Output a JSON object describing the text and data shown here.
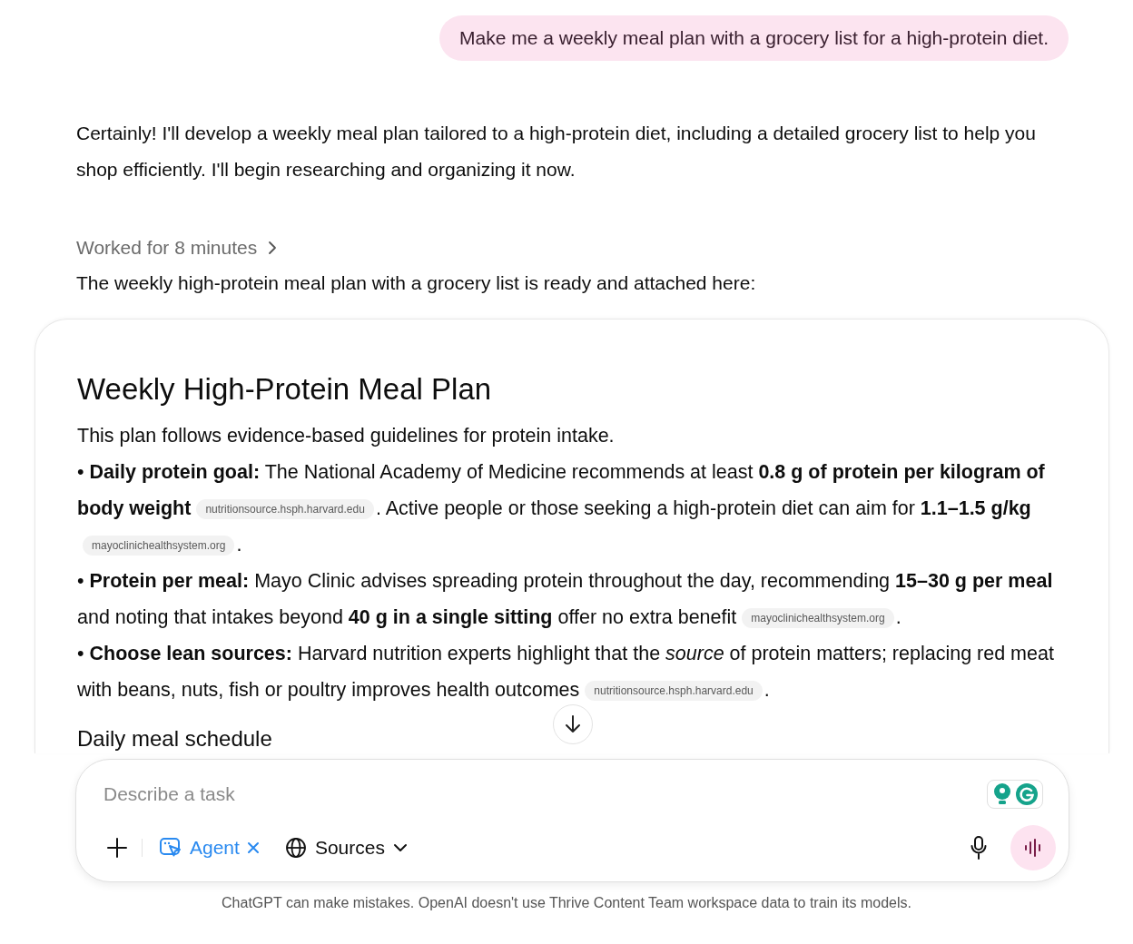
{
  "user_message": "Make me a weekly meal plan with a grocery list for a high-protein diet.",
  "assistant_intro": "Certainly! I'll develop a weekly meal plan tailored to a high-protein diet, including a detailed grocery list to help you shop efficiently. I'll begin researching and organizing it now.",
  "worked_for": "Worked for 8 minutes",
  "result_text": "The weekly high-protein meal plan with a grocery list is ready and attached here:",
  "document": {
    "title": "Weekly High-Protein Meal Plan",
    "paragraphs": [
      {
        "parts": [
          {
            "kind": "text",
            "text": "This plan follows evidence-based guidelines for protein intake."
          }
        ]
      },
      {
        "parts": [
          {
            "kind": "text",
            "text": "• **Daily protein goal:** The National Academy of Medicine recommends at least **0.8 g of protein per kilogram of body weight**"
          },
          {
            "kind": "citation",
            "text": "nutritionsource.hsph.harvard.edu"
          },
          {
            "kind": "text",
            "text": ". Active people or those seeking a high-protein diet can aim for **1.1–1.5 g/kg**"
          },
          {
            "kind": "citation",
            "text": "mayoclinichealthsystem.org"
          },
          {
            "kind": "text",
            "text": "."
          }
        ]
      },
      {
        "parts": [
          {
            "kind": "text",
            "text": "• **Protein per meal:** Mayo Clinic advises spreading protein throughout the day, recommending **15–30 g per meal** and noting that intakes beyond **40 g in a single sitting** offer no extra benefit"
          },
          {
            "kind": "citation",
            "text": "mayoclinichealthsystem.org"
          },
          {
            "kind": "text",
            "text": "."
          }
        ]
      },
      {
        "parts": [
          {
            "kind": "text",
            "text": "• **Choose lean sources:** Harvard nutrition experts highlight that the *source* of protein matters; replacing red meat with beans, nuts, fish or poultry improves health outcomes"
          },
          {
            "kind": "citation",
            "text": "nutritionsource.hsph.harvard.edu"
          },
          {
            "kind": "text",
            "text": "."
          }
        ]
      }
    ],
    "section_heading": "Daily meal schedule"
  },
  "composer": {
    "placeholder": "Describe a task",
    "tool": "Agent",
    "sources": "Sources"
  },
  "disclaimer": "ChatGPT can make mistakes. OpenAI doesn't use Thrive Content Team workspace data to train its models."
}
